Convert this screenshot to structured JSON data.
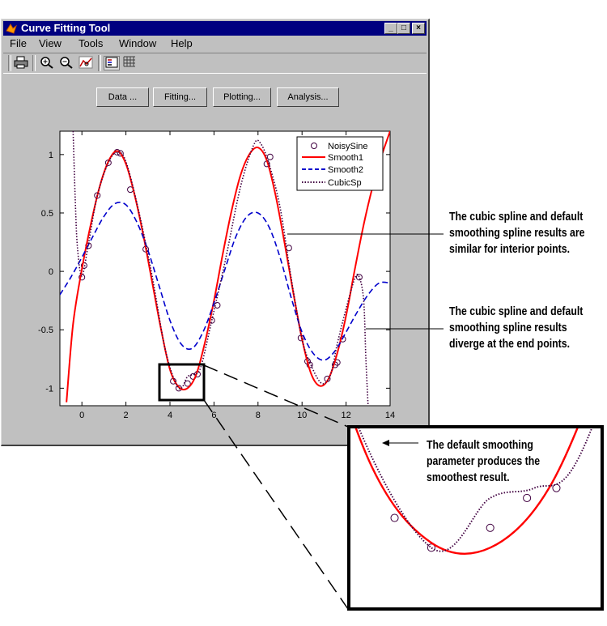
{
  "window": {
    "title": "Curve Fitting Tool",
    "controls": {
      "minimize": "_",
      "maximize": "□",
      "close": "×"
    }
  },
  "menu": {
    "items": [
      "File",
      "View",
      "Tools",
      "Window",
      "Help"
    ]
  },
  "toolbar": {
    "icons": [
      "print-icon",
      "zoom-in-icon",
      "zoom-out-icon",
      "data-cursor-icon",
      "legend-icon",
      "grid-icon"
    ]
  },
  "buttons": {
    "data": "Data ...",
    "fitting": "Fitting...",
    "plotting": "Plotting...",
    "analysis": "Analysis..."
  },
  "chart_data": {
    "type": "line",
    "xlim": [
      -1,
      14
    ],
    "ylim": [
      -1.15,
      1.2
    ],
    "xticks": [
      0,
      2,
      4,
      6,
      8,
      10,
      12,
      14
    ],
    "yticks": [
      -1,
      -0.5,
      0,
      0.5,
      1
    ],
    "legend_position": "top-right",
    "series": [
      {
        "name": "NoisySine",
        "style": "circle",
        "color": "#400040",
        "x": [
          0,
          0.1,
          0.3,
          0.7,
          1.2,
          1.6,
          1.75,
          2.2,
          2.9,
          4.15,
          4.4,
          4.8,
          5.05,
          5.25,
          5.9,
          6.15,
          8.4,
          8.55,
          9.4,
          9.95,
          10.25,
          10.35,
          11.15,
          11.5,
          11.6,
          11.85,
          12.6
        ],
        "y": [
          -0.05,
          0.05,
          0.22,
          0.65,
          0.93,
          1.02,
          1.01,
          0.7,
          0.19,
          -0.94,
          -1.0,
          -0.96,
          -0.9,
          -0.88,
          -0.42,
          -0.29,
          0.92,
          0.98,
          0.2,
          -0.57,
          -0.77,
          -0.8,
          -0.92,
          -0.8,
          -0.78,
          -0.58,
          -0.05
        ]
      },
      {
        "name": "Smooth1",
        "style": "solid",
        "color": "#ff0000",
        "x": [
          -0.7,
          -0.4,
          0,
          0.4,
          0.8,
          1.2,
          1.6,
          2.0,
          2.4,
          2.8,
          3.2,
          3.6,
          4.0,
          4.4,
          4.8,
          5.2,
          5.6,
          6.0,
          6.4,
          6.8,
          7.2,
          7.6,
          8.0,
          8.4,
          8.8,
          9.2,
          9.6,
          10.0,
          10.4,
          10.8,
          11.2,
          11.6,
          12.0,
          12.4,
          12.8,
          13.2,
          13.6,
          14.0
        ],
        "y": [
          -1.12,
          -0.45,
          0.02,
          0.4,
          0.72,
          0.94,
          1.03,
          0.92,
          0.65,
          0.3,
          -0.1,
          -0.5,
          -0.84,
          -0.99,
          -1.0,
          -0.88,
          -0.6,
          -0.25,
          0.15,
          0.52,
          0.82,
          1.0,
          1.06,
          0.95,
          0.65,
          0.25,
          -0.18,
          -0.58,
          -0.87,
          -0.98,
          -0.92,
          -0.7,
          -0.38,
          0.02,
          0.4,
          0.72,
          0.98,
          1.2
        ]
      },
      {
        "name": "Smooth2",
        "style": "dashed",
        "color": "#0000cc",
        "x": [
          -1,
          -0.5,
          0,
          0.5,
          1.0,
          1.5,
          2.0,
          2.5,
          3.0,
          3.5,
          4.0,
          4.5,
          5.0,
          5.5,
          6.0,
          6.5,
          7.0,
          7.5,
          8.0,
          8.5,
          9.0,
          9.5,
          10.0,
          10.5,
          11.0,
          11.5,
          12.0,
          12.5,
          13.0,
          13.5,
          14.0
        ],
        "y": [
          -0.2,
          -0.05,
          0.12,
          0.3,
          0.47,
          0.58,
          0.57,
          0.42,
          0.18,
          -0.12,
          -0.42,
          -0.62,
          -0.66,
          -0.52,
          -0.27,
          0.02,
          0.3,
          0.47,
          0.5,
          0.38,
          0.12,
          -0.22,
          -0.52,
          -0.7,
          -0.76,
          -0.68,
          -0.52,
          -0.35,
          -0.2,
          -0.1,
          -0.1
        ]
      },
      {
        "name": "CubicSp",
        "style": "dotted",
        "color": "#400040",
        "x": [
          -0.4,
          -0.3,
          -0.2,
          0,
          0.3,
          0.7,
          1.2,
          1.6,
          2.0,
          2.6,
          3.2,
          3.8,
          4.4,
          4.8,
          5.1,
          5.4,
          5.9,
          6.5,
          7.2,
          7.8,
          8.1,
          8.5,
          9.0,
          9.5,
          10.0,
          10.4,
          10.9,
          11.3,
          11.6,
          12.0,
          12.4,
          12.6,
          12.8,
          12.9,
          13.0
        ],
        "y": [
          1.2,
          0.6,
          0.2,
          -0.04,
          0.24,
          0.65,
          0.93,
          1.02,
          0.94,
          0.5,
          -0.05,
          -0.68,
          -1.0,
          -0.9,
          -0.88,
          -0.82,
          -0.42,
          0.08,
          0.72,
          1.08,
          1.1,
          0.92,
          0.55,
          -0.05,
          -0.58,
          -0.8,
          -0.96,
          -0.88,
          -0.62,
          -0.32,
          -0.06,
          -0.05,
          -0.25,
          -0.75,
          -1.15
        ]
      }
    ]
  },
  "annotations": {
    "interior": [
      "The cubic spline and default",
      "smoothing spline results are",
      "similar for interior points."
    ],
    "endpoints": [
      "The cubic spline and default",
      "smoothing spline results",
      "diverge at the end points."
    ],
    "zoom": [
      "The default smoothing",
      "parameter produces the",
      "smoothest result."
    ]
  }
}
